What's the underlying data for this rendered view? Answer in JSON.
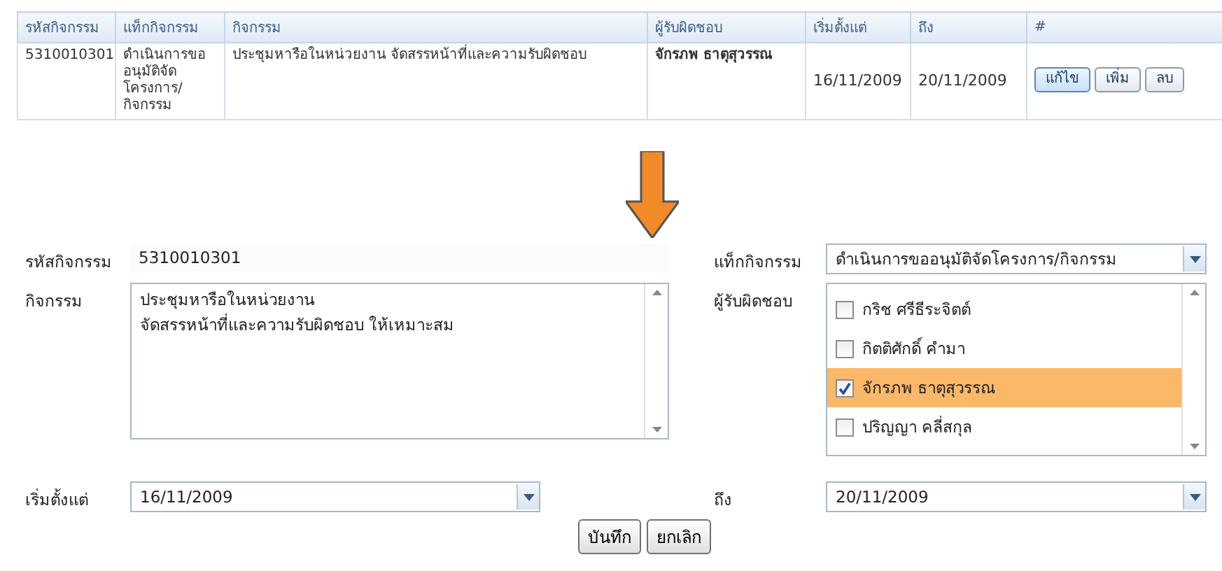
{
  "table": {
    "columns": [
      "รหัสกิจกรรม",
      "แท็กกิจกรรม",
      "กิจกรรม",
      "ผู้รับผิดชอบ",
      "เริ่มตั้งแต่",
      "ถึง",
      "#"
    ],
    "rows": [
      {
        "cells": [
          "5310010301",
          "ดำเนินการขออนุมัติจัดโครงการ/กิจกรรม",
          "ประชุมหารือในหน่วยงาน จัดสรรหน้าที่และความรับผิดชอบ",
          "จักรภพ ธาตุสุวรรณ",
          "16/11/2009",
          "20/11/2009"
        ],
        "actions": [
          "แก้ไข",
          "เพิ่ม",
          "ลบ"
        ]
      }
    ]
  },
  "form": {
    "code": {
      "label": "รหัสกิจกรรม",
      "value": "5310010301"
    },
    "tag": {
      "label": "แท็กกิจกรรม",
      "value": "ดำเนินการขออนุมัติจัดโครงการ/กิจกรรม"
    },
    "activity": {
      "label": "กิจกรรม",
      "value": "ประชุมหารือในหน่วยงาน\nจัดสรรหน้าที่และความรับผิดชอบ ให้เหมาะสม"
    },
    "responsible": {
      "label": "ผู้รับผิดชอบ",
      "options": [
        {
          "name": "กริช ศรีธีระจิตต์",
          "checked": false
        },
        {
          "name": "กิตติศักดิ์ คำมา",
          "checked": false
        },
        {
          "name": "จักรภพ ธาตุสุวรรณ",
          "checked": true
        },
        {
          "name": "ปริญญา คลี่สกุล",
          "checked": false
        }
      ]
    },
    "start": {
      "label": "เริ่มตั้งแต่",
      "value": "16/11/2009"
    },
    "end": {
      "label": "ถึง",
      "value": "20/11/2009"
    },
    "buttons": [
      "บันทึก",
      "ยกเลิก"
    ]
  }
}
